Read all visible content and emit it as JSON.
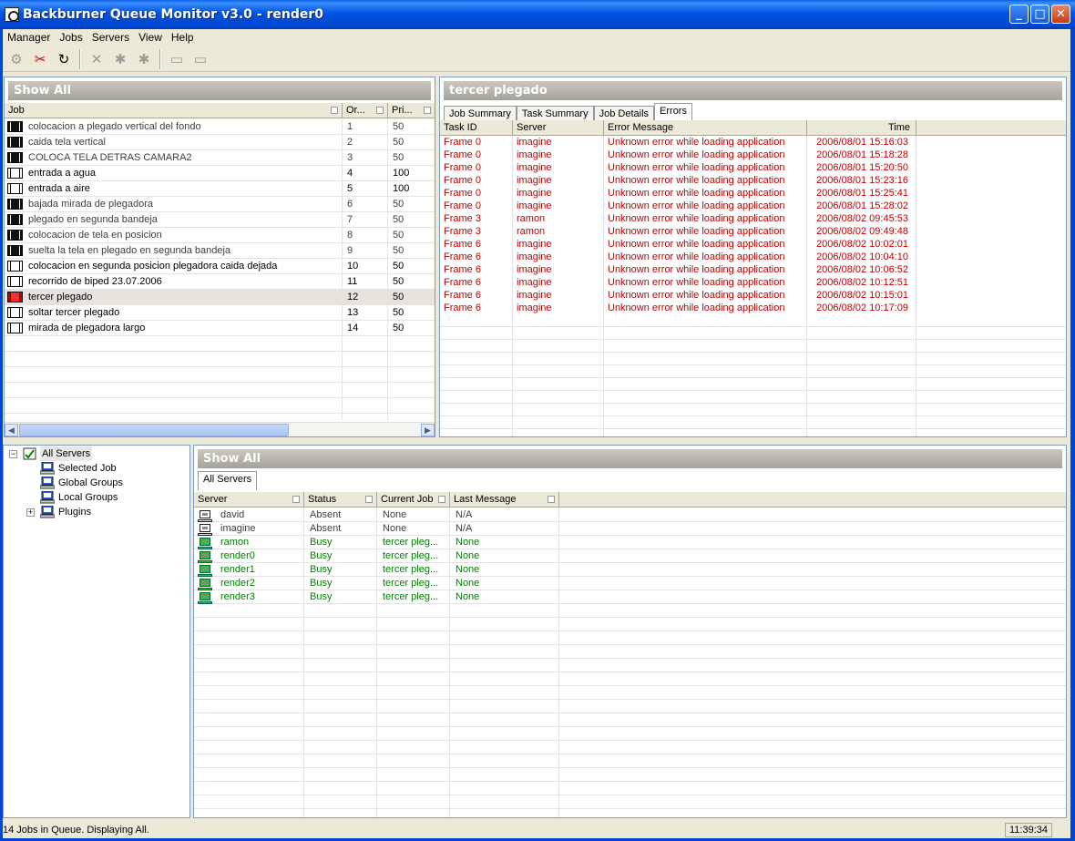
{
  "window": {
    "title": "Backburner Queue Monitor v3.0 - render0"
  },
  "menu": [
    "Manager",
    "Jobs",
    "Servers",
    "View",
    "Help"
  ],
  "jobs_panel": {
    "header": "Show All",
    "columns": [
      "Job",
      "Or...",
      "Pri..."
    ],
    "rows": [
      {
        "name": "colocacion a plegado vertical del fondo",
        "order": "1",
        "priority": "50",
        "icon": "dark",
        "active": false
      },
      {
        "name": "caida tela vertical",
        "order": "2",
        "priority": "50",
        "icon": "dark",
        "active": false
      },
      {
        "name": "COLOCA TELA DETRAS CAMARA2",
        "order": "3",
        "priority": "50",
        "icon": "dark",
        "active": false
      },
      {
        "name": "entrada a agua",
        "order": "4",
        "priority": "100",
        "icon": "light",
        "active": true
      },
      {
        "name": "entrada a aire",
        "order": "5",
        "priority": "100",
        "icon": "light",
        "active": true
      },
      {
        "name": "bajada mirada de plegadora",
        "order": "6",
        "priority": "50",
        "icon": "dark",
        "active": false
      },
      {
        "name": "plegado en segunda bandeja",
        "order": "7",
        "priority": "50",
        "icon": "dark",
        "active": false
      },
      {
        "name": "colocacion de tela en posicion",
        "order": "8",
        "priority": "50",
        "icon": "dark",
        "active": false
      },
      {
        "name": "suelta la tela en plegado en segunda bandeja",
        "order": "9",
        "priority": "50",
        "icon": "dark",
        "active": false
      },
      {
        "name": "colocacion en segunda posicion plegadora caida dejada",
        "order": "10",
        "priority": "50",
        "icon": "light",
        "active": true
      },
      {
        "name": "recorrido de biped 23.07.2006",
        "order": "11",
        "priority": "50",
        "icon": "light",
        "active": true
      },
      {
        "name": "tercer plegado",
        "order": "12",
        "priority": "50",
        "icon": "red",
        "active": true
      },
      {
        "name": "soltar tercer plegado",
        "order": "13",
        "priority": "50",
        "icon": "light",
        "active": true
      },
      {
        "name": "mirada de plegadora largo",
        "order": "14",
        "priority": "50",
        "icon": "light",
        "active": true
      }
    ]
  },
  "details_panel": {
    "header": "tercer plegado",
    "tabs": [
      "Job Summary",
      "Task Summary",
      "Job Details",
      "Errors"
    ],
    "columns": [
      "Task ID",
      "Server",
      "Error Message",
      "Time"
    ],
    "rows": [
      {
        "task": "Frame 0",
        "server": "imagine",
        "message": "Unknown error while loading application",
        "time": "2006/08/01 15:16:03"
      },
      {
        "task": "Frame 0",
        "server": "imagine",
        "message": "Unknown error while loading application",
        "time": "2006/08/01 15:18:28"
      },
      {
        "task": "Frame 0",
        "server": "imagine",
        "message": "Unknown error while loading application",
        "time": "2006/08/01 15:20:50"
      },
      {
        "task": "Frame 0",
        "server": "imagine",
        "message": "Unknown error while loading application",
        "time": "2006/08/01 15:23:16"
      },
      {
        "task": "Frame 0",
        "server": "imagine",
        "message": "Unknown error while loading application",
        "time": "2006/08/01 15:25:41"
      },
      {
        "task": "Frame 0",
        "server": "imagine",
        "message": "Unknown error while loading application",
        "time": "2006/08/01 15:28:02"
      },
      {
        "task": "Frame 3",
        "server": "ramon",
        "message": "Unknown error while loading application",
        "time": "2006/08/02 09:45:53"
      },
      {
        "task": "Frame 3",
        "server": "ramon",
        "message": "Unknown error while loading application",
        "time": "2006/08/02 09:49:48"
      },
      {
        "task": "Frame 6",
        "server": "imagine",
        "message": "Unknown error while loading application",
        "time": "2006/08/02 10:02:01"
      },
      {
        "task": "Frame 6",
        "server": "imagine",
        "message": "Unknown error while loading application",
        "time": "2006/08/02 10:04:10"
      },
      {
        "task": "Frame 6",
        "server": "imagine",
        "message": "Unknown error while loading application",
        "time": "2006/08/02 10:06:52"
      },
      {
        "task": "Frame 6",
        "server": "imagine",
        "message": "Unknown error while loading application",
        "time": "2006/08/02 10:12:51"
      },
      {
        "task": "Frame 6",
        "server": "imagine",
        "message": "Unknown error while loading application",
        "time": "2006/08/02 10:15:01"
      },
      {
        "task": "Frame 6",
        "server": "imagine",
        "message": "Unknown error while loading application",
        "time": "2006/08/02 10:17:09"
      }
    ]
  },
  "tree": {
    "root": "All Servers",
    "items": [
      "Selected Job",
      "Global Groups",
      "Local Groups",
      "Plugins"
    ]
  },
  "servers_panel": {
    "header": "Show All",
    "tab": "All Servers",
    "columns": [
      "Server",
      "Status",
      "Current Job",
      "Last Message"
    ],
    "rows": [
      {
        "server": "david",
        "status": "Absent",
        "job": "None",
        "message": "N/A",
        "state": "absent"
      },
      {
        "server": "imagine",
        "status": "Absent",
        "job": "None",
        "message": "N/A",
        "state": "absent"
      },
      {
        "server": "ramon",
        "status": "Busy",
        "job": "tercer pleg...",
        "message": "None",
        "state": "busy"
      },
      {
        "server": "render0",
        "status": "Busy",
        "job": "tercer pleg...",
        "message": "None",
        "state": "busy"
      },
      {
        "server": "render1",
        "status": "Busy",
        "job": "tercer pleg...",
        "message": "None",
        "state": "busy"
      },
      {
        "server": "render2",
        "status": "Busy",
        "job": "tercer pleg...",
        "message": "None",
        "state": "busy"
      },
      {
        "server": "render3",
        "status": "Busy",
        "job": "tercer pleg...",
        "message": "None",
        "state": "busy"
      }
    ]
  },
  "status": {
    "text": "14 Jobs in Queue. Displaying All.",
    "clock": "11:39:34"
  },
  "colors": {
    "error": "#c00000",
    "busy": "#008000",
    "titlebar": "#0054e3"
  }
}
